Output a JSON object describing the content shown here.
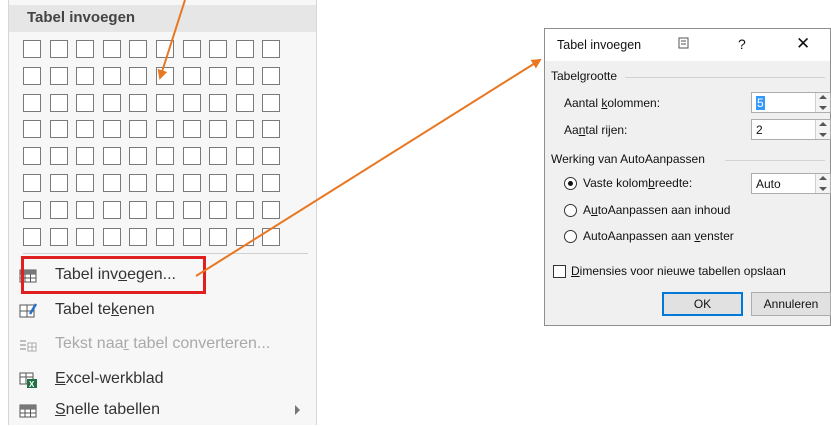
{
  "menu": {
    "header": "Tabel invoegen",
    "grid": {
      "columns": 10,
      "rows": 8
    },
    "items": [
      {
        "pre": "Tabel inv",
        "u": "o",
        "post": "egen...",
        "icon": "table-icon",
        "disabled": false
      },
      {
        "pre": "Tabel te",
        "u": "k",
        "post": "enen",
        "icon": "draw-table-icon",
        "disabled": false
      },
      {
        "pre": "Tekst naa",
        "u": "r",
        "post": " tabel converteren...",
        "icon": "text-to-table-icon",
        "disabled": true
      },
      {
        "pre": "",
        "u": "E",
        "post": "xcel-werkblad",
        "icon": "excel-icon",
        "disabled": false
      },
      {
        "pre": "",
        "u": "S",
        "post": "nelle tabellen",
        "icon": "quick-tables-icon",
        "disabled": false
      }
    ]
  },
  "dialog": {
    "title": "Tabel invoegen",
    "help": "?",
    "close": "✕",
    "size_group": "Tabelgrootte",
    "columns_label": {
      "pre": "Aantal ",
      "u": "k",
      "post": "olommen:"
    },
    "columns_value": "5",
    "rows_label": {
      "pre": "Aa",
      "u": "n",
      "post": "tal rijen:"
    },
    "rows_value": "2",
    "autofit_group": "Werking van AutoAanpassen",
    "fixed_label": {
      "pre": "Vaste kolom",
      "u": "b",
      "post": "reedte:"
    },
    "fixed_value": "Auto",
    "autofit_contents": {
      "pre": "A",
      "u": "u",
      "post": "toAanpassen aan inhoud"
    },
    "autofit_window": {
      "pre": "AutoAanpassen aan ",
      "u": "v",
      "post": "enster"
    },
    "remember": {
      "pre": "",
      "u": "D",
      "post": "imensies voor nieuwe tabellen opslaan"
    },
    "ok": "OK",
    "cancel": "Annuleren"
  },
  "colors": {
    "highlight": "#e02020",
    "arrow": "#e87722",
    "selection": "#3399ff"
  }
}
